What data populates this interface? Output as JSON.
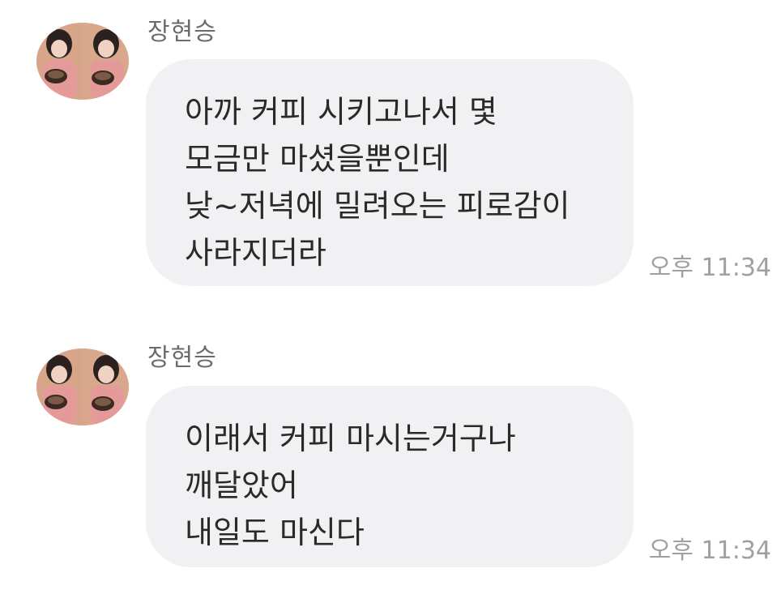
{
  "messages": [
    {
      "sender": "장현승",
      "lines": [
        "아까 커피 시키고나서 몇",
        "모금만 마셨을뿐인데",
        "낮~저녁에 밀려오는 피로감이",
        "사라지더라"
      ],
      "time": "오후 11:34",
      "avatar_icon": "profile-photo"
    },
    {
      "sender": "장현승",
      "lines": [
        "이래서 커피 마시는거구나",
        "깨달았어",
        "내일도 마신다"
      ],
      "time": "오후 11:34",
      "avatar_icon": "profile-photo"
    }
  ],
  "colors": {
    "bubble": "#f1f1f4",
    "text": "#2a2a2a",
    "sender": "#6b6b6b",
    "timestamp": "#a0a0a0"
  }
}
